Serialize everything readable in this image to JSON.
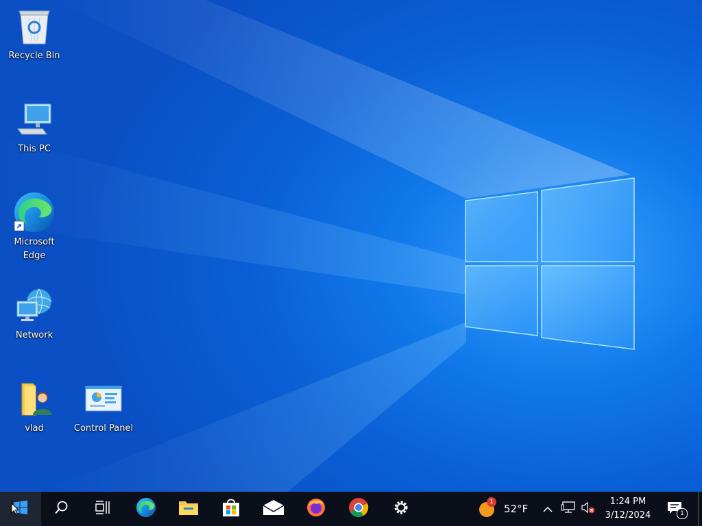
{
  "desktop": {
    "icons": [
      {
        "label": "Recycle Bin",
        "icon": "recycle-bin-icon"
      },
      {
        "label": "This PC",
        "icon": "this-pc-icon"
      },
      {
        "label": "Microsoft Edge",
        "icon": "edge-icon"
      },
      {
        "label": "Network",
        "icon": "network-icon"
      },
      {
        "label": "vlad",
        "icon": "user-folder-icon"
      },
      {
        "label": "Control Panel",
        "icon": "control-panel-icon"
      }
    ]
  },
  "taskbar": {
    "start": "start-icon",
    "pinned": [
      "search-icon",
      "task-view-icon",
      "edge-icon",
      "file-explorer-icon",
      "microsoft-store-icon",
      "mail-icon",
      "firefox-icon",
      "chrome-icon",
      "settings-icon"
    ],
    "weather": {
      "temperature": "52°F",
      "badge": "1"
    },
    "tray": [
      "show-hidden-icons-chevron",
      "network-status-icon",
      "volume-muted-icon"
    ],
    "clock": {
      "time": "1:24 PM",
      "date": "3/12/2024"
    },
    "notifications": {
      "badge": "1"
    }
  },
  "colors": {
    "desktop_blue": "#0a63d8",
    "taskbar": "#0b0f1a",
    "logo_glow": "#7fd0ff"
  }
}
